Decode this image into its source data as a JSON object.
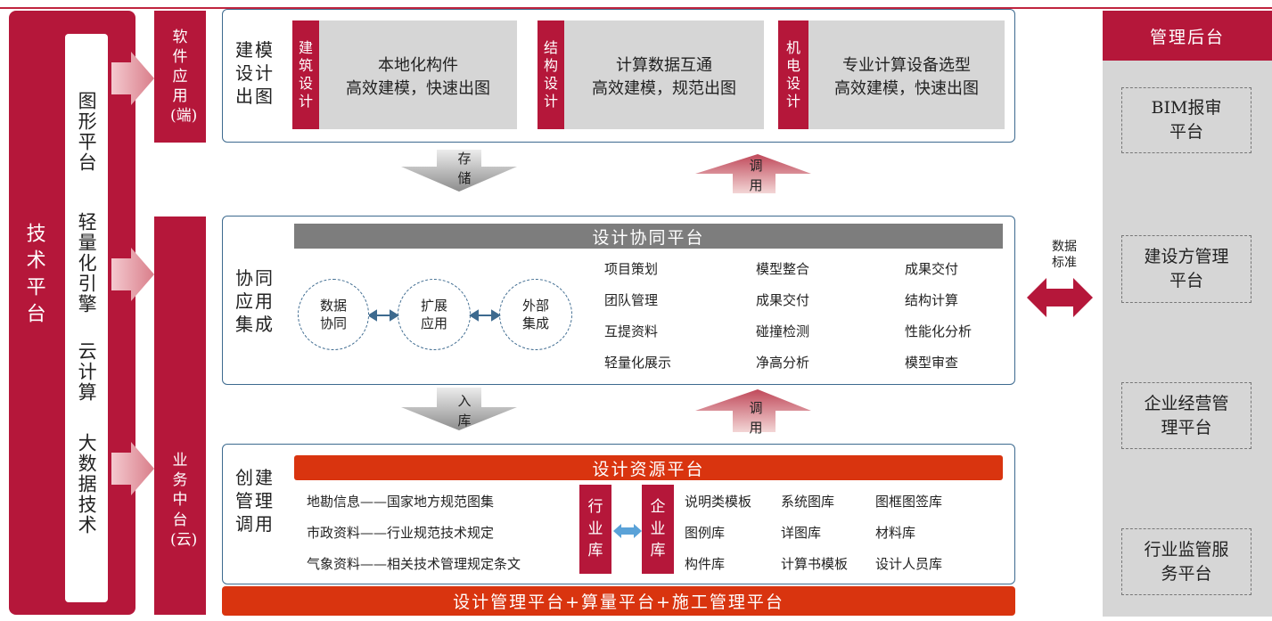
{
  "tech_platform": {
    "title": "技术平台",
    "items": [
      "图形平台",
      "轻量化引擎",
      "云计算",
      "大数据技术"
    ]
  },
  "software_app": "软件应用(端)",
  "business_center": "业务中台(云)",
  "modeling": {
    "label": "建模设计出图",
    "cards": [
      {
        "tag": "建筑设计",
        "line1": "本地化构件",
        "line2": "高效建模，快速出图"
      },
      {
        "tag": "结构设计",
        "line1": "计算数据互通",
        "line2": "高效建模，规范出图"
      },
      {
        "tag": "机电设计",
        "line1": "专业计算设备选型",
        "line2": "高效建模，快速出图"
      }
    ]
  },
  "arrows": {
    "store": "存储",
    "call1": "调用",
    "import": "入库",
    "call2": "调用"
  },
  "collab": {
    "label": "协同应用集成",
    "platform_title": "设计协同平台",
    "circles": [
      "数据协同",
      "扩展应用",
      "外部集成"
    ],
    "items": [
      [
        "项目策划",
        "模型整合",
        "成果交付"
      ],
      [
        "团队管理",
        "成果交付",
        "结构计算"
      ],
      [
        "互提资料",
        "碰撞检测",
        "性能化分析"
      ],
      [
        "轻量化展示",
        "净高分析",
        "模型审查"
      ]
    ]
  },
  "resource": {
    "label": "创建管理调用",
    "platform_title": "设计资源平台",
    "left_items": [
      "地勘信息——国家地方规范图集",
      "市政资料——行业规范技术规定",
      "气象资料——相关技术管理规定条文"
    ],
    "industry_lib": "行业库",
    "enterprise_lib": "企业库",
    "right_items": [
      [
        "说明类模板",
        "系统图库",
        "图框图签库"
      ],
      [
        "图例库",
        "详图库",
        "材料库"
      ],
      [
        "构件库",
        "计算书模板",
        "设计人员库"
      ]
    ]
  },
  "bottom_bar": "设计管理平台+算量平台+施工管理平台",
  "data_standard": "数据标准",
  "admin": {
    "title": "管理后台",
    "boxes": [
      "BIM报审平台",
      "建设方管理平台",
      "企业经营管理平台",
      "行业监管服务平台"
    ]
  },
  "colors": {
    "brand_red": "#b5173a",
    "orange_red": "#d9340f",
    "panel_border": "#3d6a8f",
    "grey": "#d6d6d6"
  }
}
